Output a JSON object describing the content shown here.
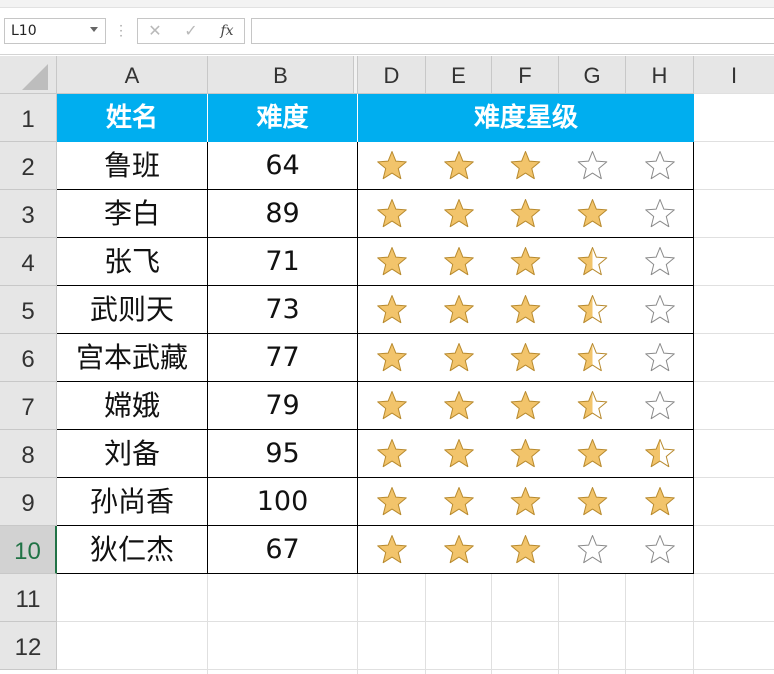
{
  "name_box": "L10",
  "formula_bar": {
    "cancel": "✕",
    "enter": "✓",
    "fx": "fx",
    "value": ""
  },
  "columns": [
    "A",
    "B",
    "D",
    "E",
    "F",
    "G",
    "H",
    "I"
  ],
  "rows": [
    "1",
    "2",
    "3",
    "4",
    "5",
    "6",
    "7",
    "8",
    "9",
    "10",
    "11",
    "12"
  ],
  "active_row": "10",
  "header": {
    "name": "姓名",
    "difficulty": "难度",
    "stars": "难度星级"
  },
  "records": [
    {
      "name": "鲁班",
      "difficulty": "64",
      "star_fill": [
        1,
        1,
        1,
        0,
        0
      ]
    },
    {
      "name": "李白",
      "difficulty": "89",
      "star_fill": [
        1,
        1,
        1,
        1,
        0
      ]
    },
    {
      "name": "张飞",
      "difficulty": "71",
      "star_fill": [
        1,
        1,
        1,
        0.5,
        0
      ]
    },
    {
      "name": "武则天",
      "difficulty": "73",
      "star_fill": [
        1,
        1,
        1,
        0.5,
        0
      ]
    },
    {
      "name": "宫本武藏",
      "difficulty": "77",
      "star_fill": [
        1,
        1,
        1,
        0.5,
        0
      ]
    },
    {
      "name": "嫦娥",
      "difficulty": "79",
      "star_fill": [
        1,
        1,
        1,
        0.5,
        0
      ]
    },
    {
      "name": "刘备",
      "difficulty": "95",
      "star_fill": [
        1,
        1,
        1,
        1,
        0.5
      ]
    },
    {
      "name": "孙尚香",
      "difficulty": "100",
      "star_fill": [
        1,
        1,
        1,
        1,
        1
      ]
    },
    {
      "name": "狄仁杰",
      "difficulty": "67",
      "star_fill": [
        1,
        1,
        1,
        0,
        0
      ]
    }
  ],
  "colors": {
    "header_bg": "#00aeef",
    "star_fill": "#f2c46b",
    "star_stroke": "#b88a2e",
    "empty_star_stroke": "#8a8a8a",
    "active_row": "#217346"
  },
  "icons": {
    "star": "star-icon",
    "dropdown": "chevron-down-icon"
  }
}
